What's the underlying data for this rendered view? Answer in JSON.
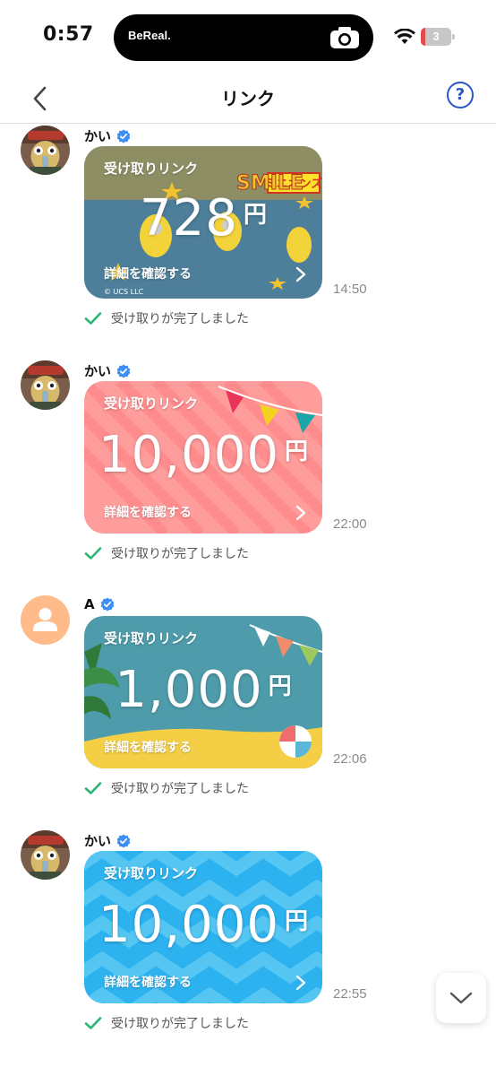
{
  "status_bar": {
    "time": "0:57",
    "island_app": "BeReal.",
    "battery_level": "3"
  },
  "header": {
    "title": "リンク",
    "help_label": "?"
  },
  "messages": [
    {
      "sender": "かい",
      "avatar": "character-avatar",
      "card_theme": "minions",
      "card_label": "受け取りリンク",
      "amount": "728",
      "currency": "円",
      "detail_label": "詳細を確認する",
      "copyright": "© UCS LLC",
      "banner_text": "ミニオンズ",
      "timestamp": "14:50",
      "status": "受け取りが完了しました"
    },
    {
      "sender": "かい",
      "avatar": "character-avatar",
      "card_theme": "pink-party",
      "card_label": "受け取りリンク",
      "amount": "10,000",
      "currency": "円",
      "detail_label": "詳細を確認する",
      "timestamp": "22:00",
      "status": "受け取りが完了しました"
    },
    {
      "sender": "A",
      "avatar": "default-person-avatar",
      "card_theme": "beach",
      "card_label": "受け取りリンク",
      "amount": "1,000",
      "currency": "円",
      "detail_label": "詳細を確認する",
      "timestamp": "22:06",
      "status": "受け取りが完了しました"
    },
    {
      "sender": "かい",
      "avatar": "character-avatar",
      "card_theme": "blue-zigzag",
      "card_label": "受け取りリンク",
      "amount": "10,000",
      "currency": "円",
      "detail_label": "詳細を確認する",
      "timestamp": "22:55",
      "status": "受け取りが完了しました"
    }
  ],
  "colors": {
    "accent_blue": "#2a55c8",
    "verified_blue": "#3d8ef5",
    "check_green": "#2bb673",
    "card_minions": "#4d7f9a",
    "card_pink": "#ff9a9a",
    "card_beach": "#4e9cab",
    "card_blue": "#2db2f0"
  }
}
